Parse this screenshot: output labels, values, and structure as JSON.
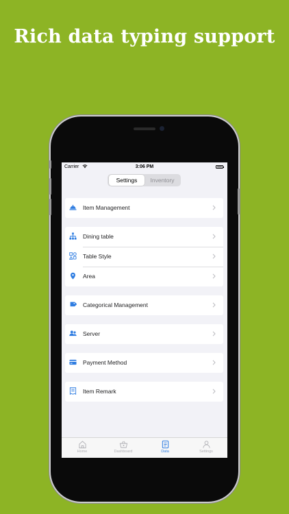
{
  "headline": "Rich data typing support",
  "status_bar": {
    "carrier": "Carrier",
    "time": "3:06 PM"
  },
  "segmented": {
    "tabs": [
      "Settings",
      "Inventory"
    ],
    "selected": "Settings"
  },
  "groups": [
    [
      {
        "label": "Item Management",
        "icon": "dish-cover-icon"
      }
    ],
    [
      {
        "label": "Dining table",
        "icon": "hierarchy-icon"
      },
      {
        "label": "Table Style",
        "icon": "shapes-icon"
      },
      {
        "label": "Area",
        "icon": "location-pin-icon"
      }
    ],
    [
      {
        "label": "Categorical Management",
        "icon": "tags-icon"
      }
    ],
    [
      {
        "label": "Server",
        "icon": "people-icon"
      }
    ],
    [
      {
        "label": "Payment Method",
        "icon": "credit-card-icon"
      }
    ],
    [
      {
        "label": "Item Remark",
        "icon": "receipt-icon"
      }
    ]
  ],
  "tab_bar": {
    "items": [
      {
        "label": "Home",
        "icon": "home-icon"
      },
      {
        "label": "Dashboard",
        "icon": "basket-icon"
      },
      {
        "label": "Data",
        "icon": "document-icon"
      },
      {
        "label": "Settings",
        "icon": "person-icon"
      }
    ],
    "selected": "Data"
  },
  "colors": {
    "background": "#8db425",
    "accent": "#2f7de1",
    "screen_bg": "#f2f2f7"
  }
}
